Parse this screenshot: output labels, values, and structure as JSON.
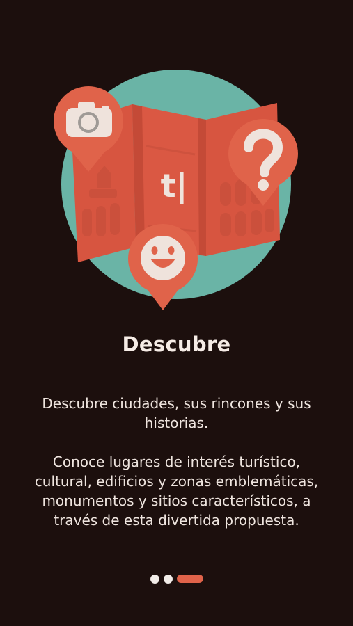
{
  "onboarding": {
    "logo_text": "t|",
    "title": "Descubre",
    "paragraph_1": "Descubre ciudades, sus rincones y sus historias.",
    "paragraph_2": "Conoce lugares de interés turístico, cultural, edificios y zonas emblemáticas, monumentos y sitios característicos, a través de esta divertida propuesta.",
    "pages_total": 3,
    "active_page": 3,
    "pin_icons": [
      "camera-icon",
      "question-mark-icon",
      "smiley-icon"
    ]
  },
  "colors": {
    "background": "#1c0f0d",
    "circle": "#6ab4a6",
    "map": "#d9533f",
    "pin": "#e0634a",
    "accent_light": "#efe3dc",
    "active_dot": "#e0634a",
    "inactive_dot": "#f2ece8"
  }
}
